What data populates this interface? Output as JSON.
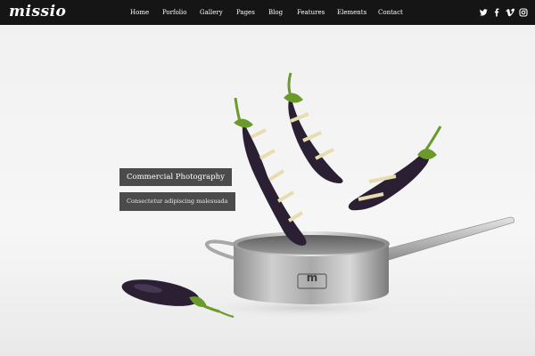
{
  "brand": {
    "logo_text": "missio"
  },
  "nav": {
    "items": [
      {
        "label": "Home"
      },
      {
        "label": "Porfolio"
      },
      {
        "label": "Gallery"
      },
      {
        "label": "Pages"
      },
      {
        "label": "Blog"
      },
      {
        "label": "Features"
      },
      {
        "label": "Elements"
      },
      {
        "label": "Contact"
      }
    ]
  },
  "social": {
    "icons": [
      "twitter-icon",
      "facebook-icon",
      "vimeo-icon",
      "instagram-icon"
    ]
  },
  "hero": {
    "title": "Commercial Photography",
    "subtitle": "Consectetur adipiscing malesuada",
    "pan_emblem": "m"
  },
  "colors": {
    "header_bg": "#151515",
    "caption_bg": "#4b4b4b",
    "eggplant": "#2a1f33",
    "stem_green": "#6a9a2a"
  }
}
